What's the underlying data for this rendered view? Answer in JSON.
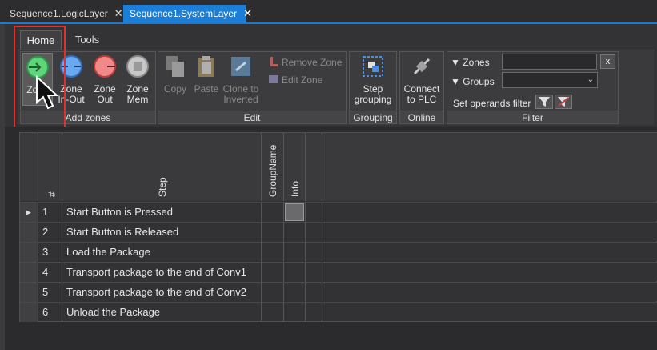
{
  "doc_tabs": [
    {
      "label": "Sequence1.LogicLayer",
      "close": "✕"
    },
    {
      "label": "Sequence1.SystemLayer",
      "close": "✕"
    }
  ],
  "ribbon": {
    "tabs": [
      "Home",
      "Tools"
    ],
    "add_zones": {
      "label": "Add zones",
      "buttons": [
        {
          "label": "Zone",
          "icon": "zone-green-icon",
          "color": "#3fbf5f"
        },
        {
          "label": "Zone\nIn-Out",
          "icon": "zone-in-out-icon",
          "color": "#4a8fe0"
        },
        {
          "label": "Zone\nOut",
          "icon": "zone-out-icon",
          "color": "#e05a5a"
        },
        {
          "label": "Zone\nMem",
          "icon": "zone-mem-icon",
          "color": "#b0b0b0"
        }
      ]
    },
    "edit": {
      "label": "Edit",
      "buttons": [
        "Copy",
        "Paste",
        "Clone to\nInverted"
      ],
      "small": [
        "Remove Zone",
        "Edit Zone"
      ]
    },
    "grouping": {
      "label": "Grouping",
      "button": "Step\ngrouping"
    },
    "online": {
      "label": "Online",
      "button": "Connect\nto PLC"
    },
    "filter": {
      "label": "Filter",
      "zones_label": "Zones",
      "groups_label": "Groups",
      "clear": "x",
      "set_operands": "Set operands filter"
    }
  },
  "grid": {
    "headers": {
      "num": "#",
      "step": "Step",
      "group": "GroupName",
      "info": "Info"
    },
    "rows": [
      {
        "n": "1",
        "step": "Start Button is Pressed",
        "current": true
      },
      {
        "n": "2",
        "step": "Start Button is Released"
      },
      {
        "n": "3",
        "step": "Load the Package"
      },
      {
        "n": "4",
        "step": "Transport package to the end of Conv1"
      },
      {
        "n": "5",
        "step": "Transport package to the end of Conv2"
      },
      {
        "n": "6",
        "step": "Unload the Package"
      }
    ]
  }
}
